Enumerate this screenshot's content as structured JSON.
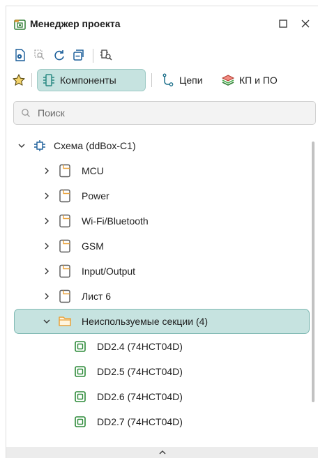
{
  "window": {
    "title": "Менеджер проекта",
    "icon": "project-manager-icon",
    "controls": [
      "maximize-icon",
      "close-icon"
    ]
  },
  "toolbar": {
    "icons": [
      "show-document-icon",
      "zoom-to-selection-icon",
      "refresh-icon",
      "collapse-all-icon",
      "find-component-icon"
    ]
  },
  "tabs": [
    {
      "label": "",
      "icon": "star-icon",
      "active": false
    },
    {
      "label": "Компоненты",
      "icon": "component-icon",
      "active": true
    },
    {
      "label": "Цепи",
      "icon": "net-icon",
      "active": false
    },
    {
      "label": "КП и ПО",
      "icon": "layers-icon",
      "active": false
    }
  ],
  "search": {
    "placeholder": "Поиск",
    "value": ""
  },
  "tree": {
    "root": {
      "label": "Схема (ddBox-C1)",
      "expanded": true,
      "icon": "schematic-icon"
    },
    "sheets": [
      {
        "label": "MCU",
        "icon": "sheet-icon"
      },
      {
        "label": "Power",
        "icon": "sheet-icon"
      },
      {
        "label": "Wi-Fi/Bluetooth",
        "icon": "sheet-icon"
      },
      {
        "label": "GSM",
        "icon": "sheet-icon"
      },
      {
        "label": "Input/Output",
        "icon": "sheet-icon"
      },
      {
        "label": "Лист 6",
        "icon": "sheet-icon"
      }
    ],
    "unused": {
      "label": "Неиспользуемые секции (4)",
      "expanded": true,
      "selected": true,
      "icon": "folder-icon"
    },
    "parts": [
      {
        "label": "DD2.4 (74HCT04D)",
        "icon": "chip-icon"
      },
      {
        "label": "DD2.5 (74HCT04D)",
        "icon": "chip-icon"
      },
      {
        "label": "DD2.6 (74HCT04D)",
        "icon": "chip-icon"
      },
      {
        "label": "DD2.7 (74HCT04D)",
        "icon": "chip-icon"
      }
    ]
  },
  "colors": {
    "accent": "#2a8a82",
    "selection": "#c6e3e0",
    "chip": "#2e8b3a",
    "folder": "#e8a13a"
  }
}
